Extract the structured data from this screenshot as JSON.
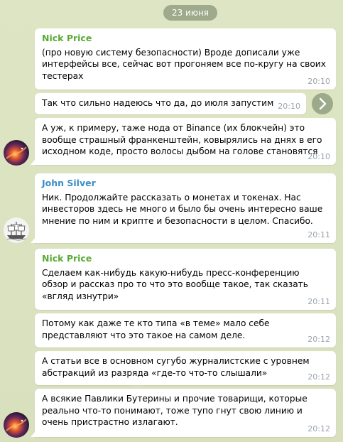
{
  "date_separator": "23 июня",
  "messages": [
    {
      "sender": "Nick Price",
      "text": "(про новую систему безопасности) Вроде дописали уже интерфейсы все, сейчас вот прогоняем все по-кругу на своих тестерах",
      "time": "20:10"
    },
    {
      "text": "Так что сильно надеюсь что да, до июля запустим",
      "time": "20:10"
    },
    {
      "text": "А уж, к примеру, таже нода от Binance (их блокчейн) это вообще страшный франкенштейн, ковырялись на днях в его исходном коде, просто волосы дыбом на голове становятся",
      "time": "20:10"
    },
    {
      "sender": "John Silver",
      "text": "Ник. Продолжайте рассказать о монетах и токенах. Нас инвесторов здесь не много и было бы очень интересно ваше мнение по ним и крипте и безопасности в целом. Спасибо.",
      "time": "20:11"
    },
    {
      "sender": "Nick Price",
      "text": "Сделаем как-нибудь какую-нибудь пресс-конференцию обзор и рассказ про то что это вообще такое, так сказать «вгляд изнутри»",
      "time": "20:11"
    },
    {
      "text": "Потому как даже те кто типа «в теме» мало себе представляют что это такое на самом деле.",
      "time": "20:12"
    },
    {
      "text": "А статьи все в основном сугубо журналистские с уровнем абстракций из разряда «где-то что-то слышали»",
      "time": "20:12"
    },
    {
      "text": "А всякие Павлики Бутерины и прочие товарищи, которые реально что-то понимают, тоже тупо гнут свою линию и очень пристрастно излагают.",
      "time": "20:12"
    }
  ],
  "colors": {
    "nick": "#5aab35",
    "john": "#3a8dc7",
    "pill": "#6b7a5e"
  },
  "icons": {
    "forward": "chevron-right-icon",
    "avatar_nick": "nebula-avatar",
    "avatar_john": "ship-avatar"
  }
}
